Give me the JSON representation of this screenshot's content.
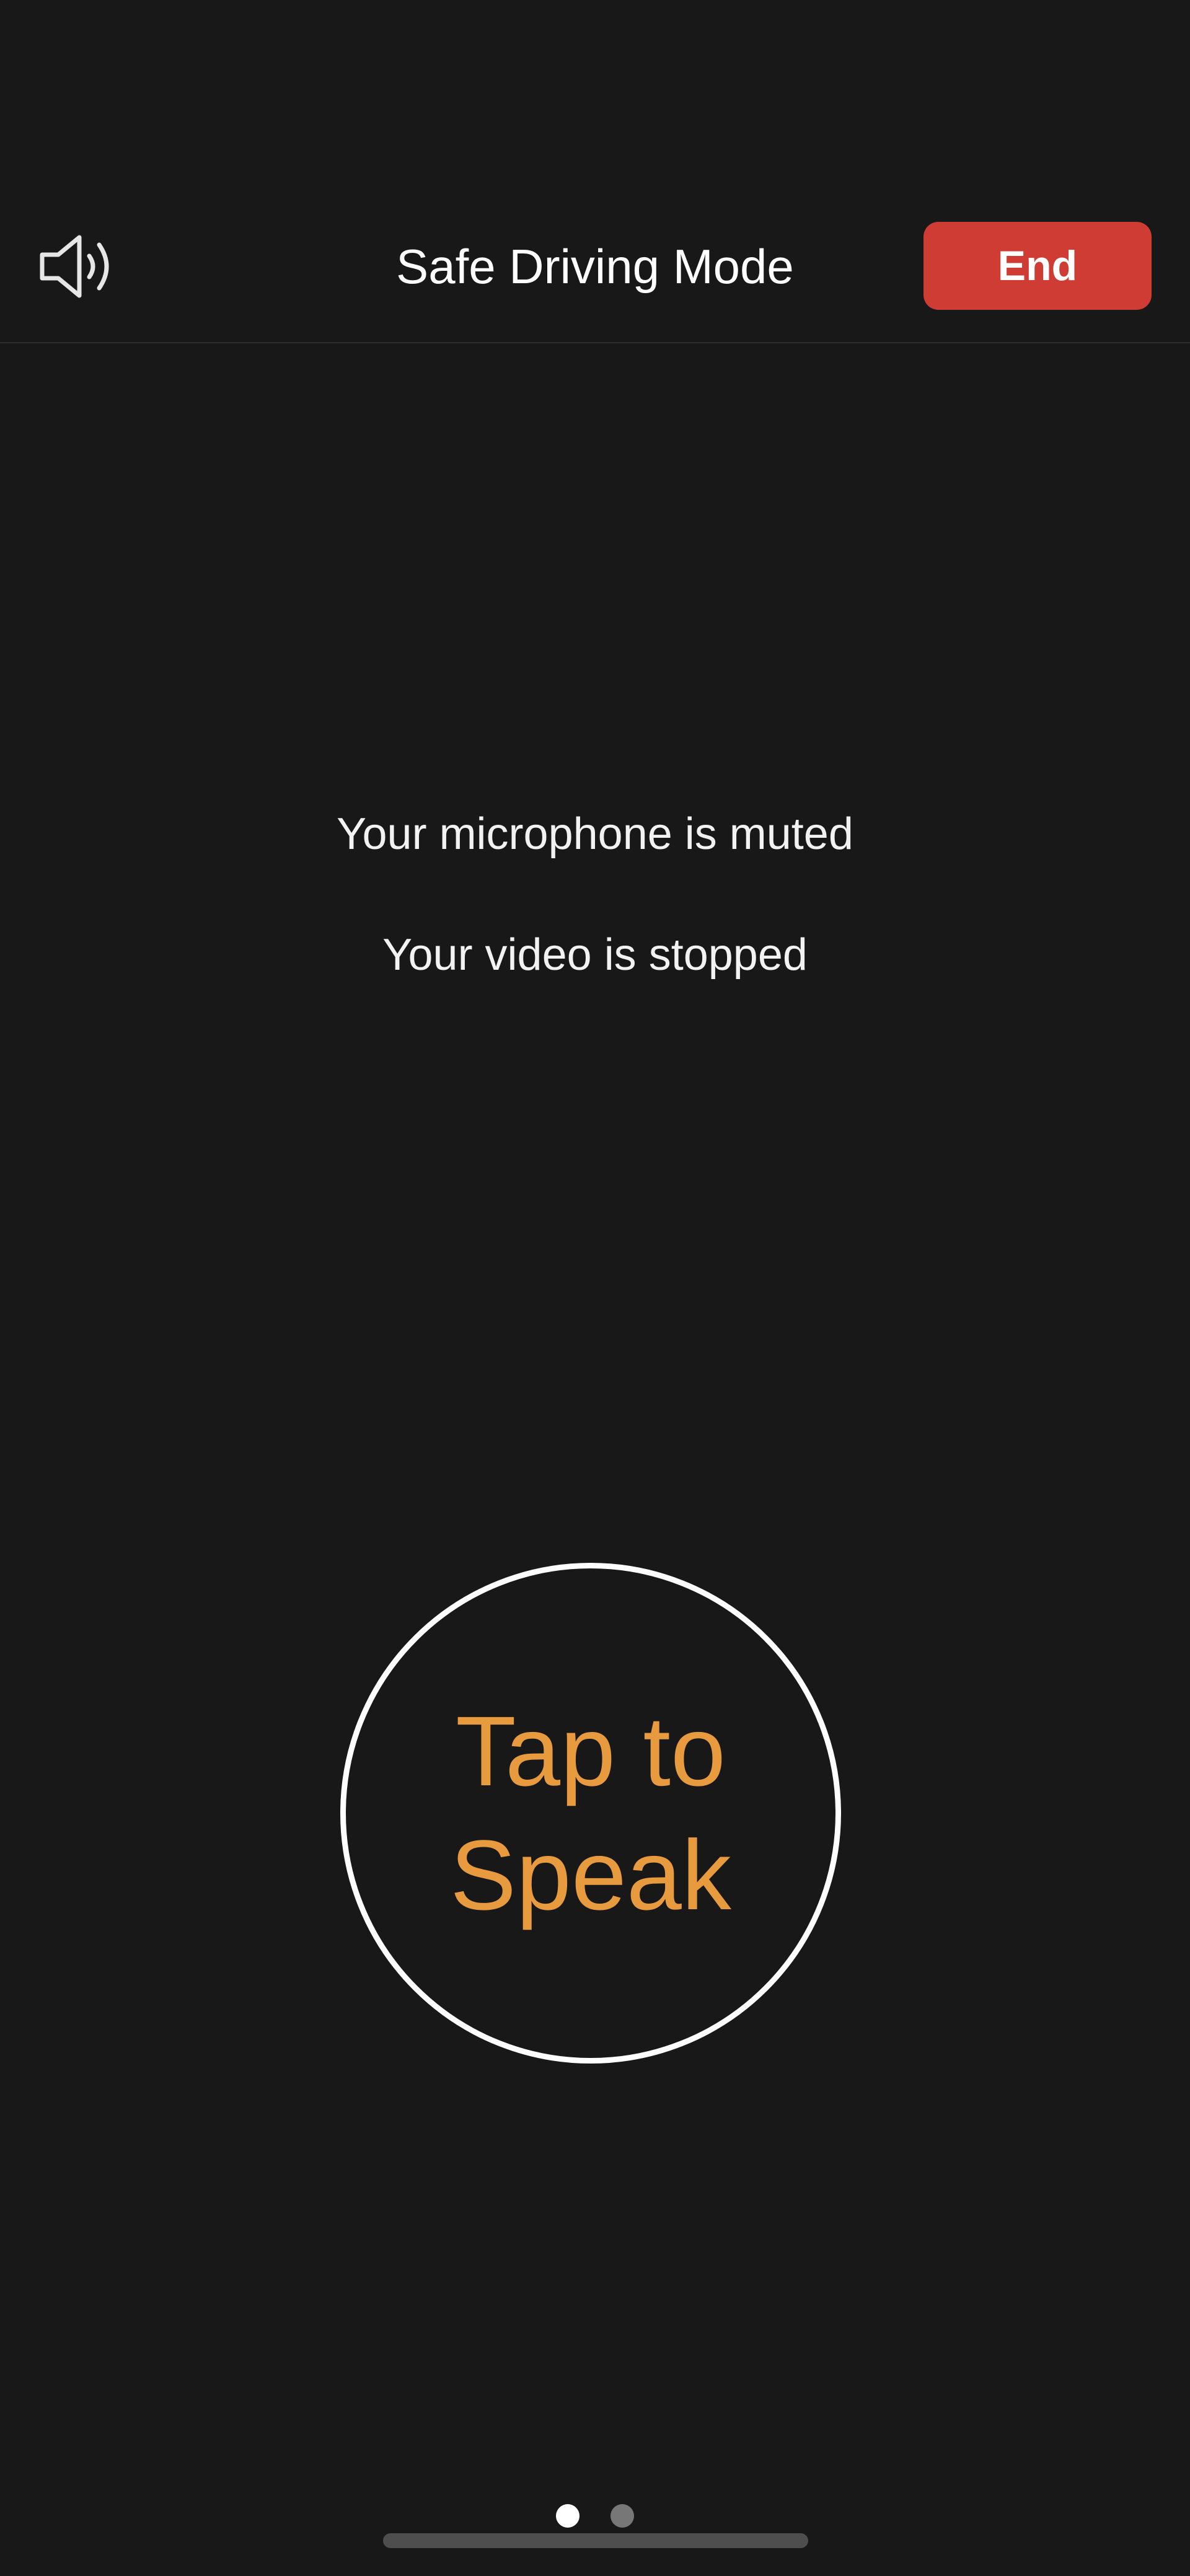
{
  "header": {
    "speaker_icon": "speaker-wave-icon",
    "title": "Safe Driving Mode",
    "end_label": "End",
    "end_color": "#cf3c34"
  },
  "status": {
    "microphone": "Your microphone is muted",
    "video": "Your video is stopped"
  },
  "speak_button": {
    "line1": "Tap to",
    "line2": "Speak",
    "label_color": "#e79a3e"
  },
  "pager": {
    "page_count": 2,
    "active_page": 1
  },
  "colors": {
    "background": "#181818",
    "divider": "#2c2c2c"
  }
}
